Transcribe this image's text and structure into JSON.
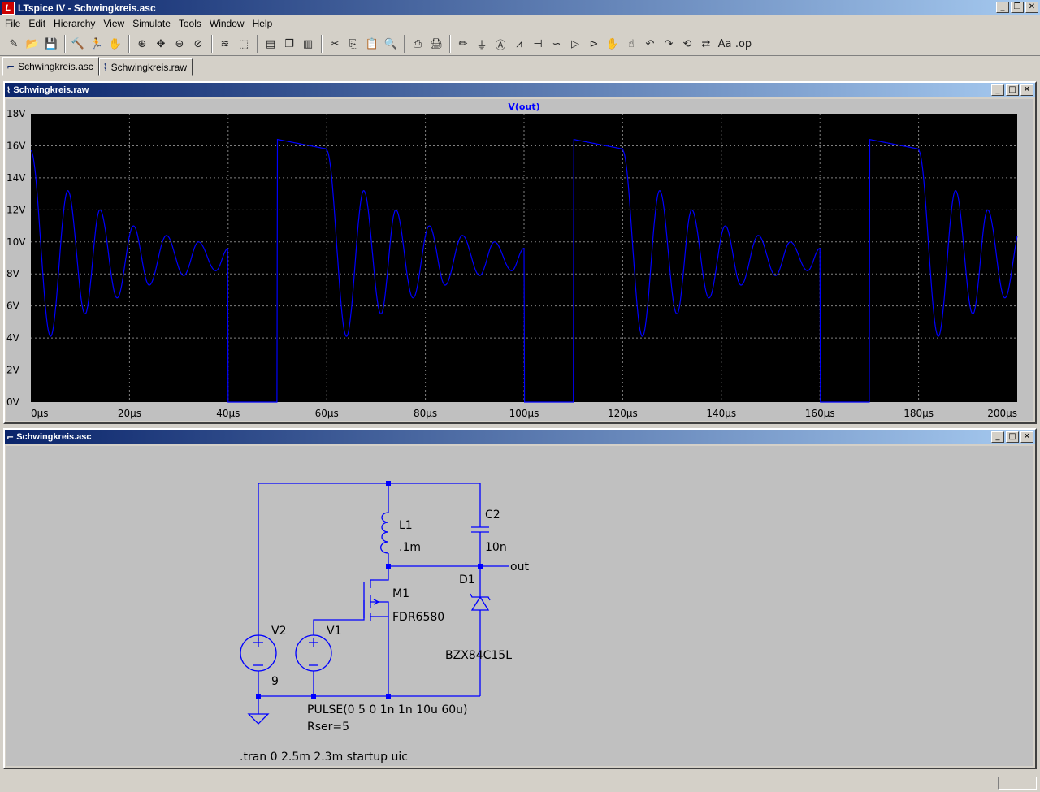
{
  "window": {
    "title": "LTspice IV - Schwingkreis.asc"
  },
  "menu": [
    {
      "label": "File",
      "key": "F"
    },
    {
      "label": "Edit",
      "key": "E"
    },
    {
      "label": "Hierarchy",
      "key": "H"
    },
    {
      "label": "View",
      "key": "V"
    },
    {
      "label": "Simulate",
      "key": "S"
    },
    {
      "label": "Tools",
      "key": "T"
    },
    {
      "label": "Window",
      "key": "W"
    },
    {
      "label": "Help",
      "key": "H"
    }
  ],
  "toolbar_icons": [
    "new-schematic",
    "open",
    "save",
    "control-panel",
    "run",
    "halt",
    "zoom-in",
    "pan",
    "zoom-out",
    "zoom-cancel",
    "autorange",
    "fit",
    "tile-horizontal",
    "cascade",
    "tile-vertical",
    "cut",
    "copy",
    "paste",
    "find",
    "print-preview",
    "print",
    "draw-wire",
    "ground",
    "label-net",
    "resistor",
    "capacitor",
    "inductor",
    "diode",
    "component",
    "move",
    "drag",
    "undo",
    "redo",
    "rotate",
    "mirror",
    "text",
    "spice-directive"
  ],
  "tabs": [
    {
      "label": "Schwingkreis.asc",
      "icon": "schematic-icon",
      "active": true
    },
    {
      "label": "Schwingkreis.raw",
      "icon": "waveform-icon",
      "active": false
    }
  ],
  "plot": {
    "window_title": "Schwingkreis.raw",
    "colors": {
      "background": "#000000",
      "trace": "#0000ff",
      "grid": "#808080",
      "axis_text": "#000000"
    }
  },
  "chart_data": {
    "type": "line",
    "title": "V(out)",
    "xlabel": "",
    "ylabel": "",
    "xlim": [
      0,
      200
    ],
    "ylim": [
      0,
      18
    ],
    "x_ticks": [
      "0µs",
      "20µs",
      "40µs",
      "60µs",
      "80µs",
      "100µs",
      "120µs",
      "140µs",
      "160µs",
      "180µs",
      "200µs"
    ],
    "y_ticks": [
      "0V",
      "2V",
      "4V",
      "6V",
      "8V",
      "10V",
      "12V",
      "14V",
      "16V",
      "18V"
    ],
    "grid": true,
    "series": [
      {
        "name": "V(out)",
        "color": "#0000ff",
        "period_us": 60,
        "waveform": {
          "off_ring": {
            "start_us": 0,
            "end_us": 40,
            "initial_v": 15.7,
            "dc_level_v": 9.0,
            "extrema": [
              [
                0,
                15.7
              ],
              [
                4,
                4.1
              ],
              [
                7.5,
                13.2
              ],
              [
                11,
                5.5
              ],
              [
                14,
                12.0
              ],
              [
                17.5,
                6.5
              ],
              [
                20.8,
                11.0
              ],
              [
                24,
                7.3
              ],
              [
                27.5,
                10.4
              ],
              [
                31,
                7.9
              ],
              [
                34,
                10.0
              ],
              [
                37.5,
                8.2
              ],
              [
                40,
                9.6
              ]
            ]
          },
          "low": {
            "start_us": 40,
            "end_us": 50,
            "v": 0
          },
          "pulse": {
            "start_us": 50,
            "end_us": 60,
            "v_start": 16.4,
            "v_end": 15.8
          }
        }
      }
    ]
  },
  "schematic": {
    "window_title": "Schwingkreis.asc",
    "colors": {
      "wire": "#0000ff",
      "background": "#c0c0c0",
      "text": "#000000",
      "net_node": "#0000ff"
    },
    "components": {
      "L1": {
        "name": "L1",
        "value": ".1m"
      },
      "C2": {
        "name": "C2",
        "value": "10n"
      },
      "M1": {
        "name": "M1",
        "value": "FDR6580"
      },
      "D1": {
        "name": "D1",
        "value": "BZX84C15L"
      },
      "V1": {
        "name": "V1",
        "value": "PULSE(0 5 0 1n 1n 10u 60u)",
        "rser": "Rser=5"
      },
      "V2": {
        "name": "V2",
        "value": "9"
      }
    },
    "net_label": "out",
    "directive": ".tran 0 2.5m 2.3m startup uic"
  }
}
